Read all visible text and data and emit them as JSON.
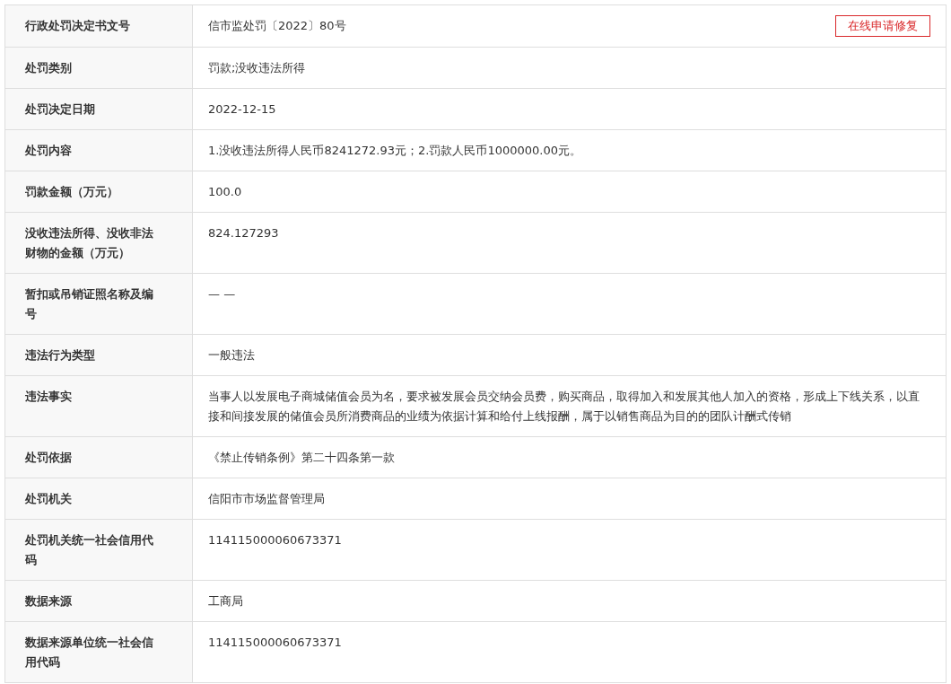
{
  "rows": [
    {
      "label": "行政处罚决定书文号",
      "value": "信市监处罚〔2022〕80号",
      "action": "在线申请修复"
    },
    {
      "label": "处罚类别",
      "value": "罚款;没收违法所得"
    },
    {
      "label": "处罚决定日期",
      "value": "2022-12-15"
    },
    {
      "label": "处罚内容",
      "value": "1.没收违法所得人民币8241272.93元；2.罚款人民币1000000.00元。"
    },
    {
      "label": "罚款金额（万元）",
      "value": "100.0"
    },
    {
      "label": "没收违法所得、没收非法财物的金额（万元）",
      "value": "824.127293"
    },
    {
      "label": "暂扣或吊销证照名称及编号",
      "value": "— —"
    },
    {
      "label": "违法行为类型",
      "value": "一般违法"
    },
    {
      "label": "违法事实",
      "value": "当事人以发展电子商城储值会员为名，要求被发展会员交纳会员费，购买商品，取得加入和发展其他人加入的资格，形成上下线关系，以直接和间接发展的储值会员所消费商品的业绩为依据计算和给付上线报酬，属于以销售商品为目的的团队计酬式传销"
    },
    {
      "label": "处罚依据",
      "value": "《禁止传销条例》第二十四条第一款"
    },
    {
      "label": "处罚机关",
      "value": "信阳市市场监督管理局"
    },
    {
      "label": "处罚机关统一社会信用代码",
      "value": "114115000060673371"
    },
    {
      "label": "数据来源",
      "value": "工商局"
    },
    {
      "label": "数据来源单位统一社会信用代码",
      "value": "114115000060673371"
    }
  ]
}
